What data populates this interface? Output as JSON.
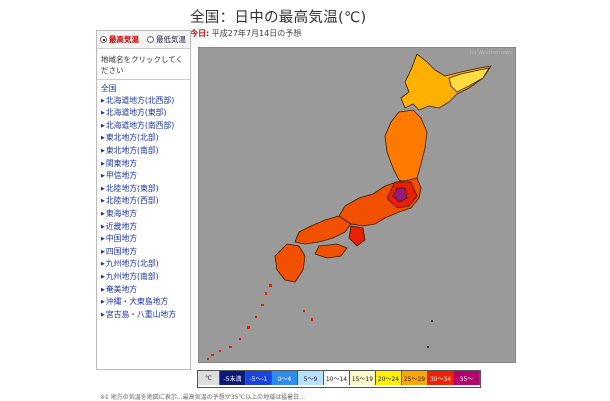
{
  "header": {
    "title": "全国：日中の最高気温(℃)",
    "today_label": "今日:",
    "date_text": "平成27年7月14日の予想"
  },
  "sidebar": {
    "options": [
      {
        "label": "最高気温",
        "selected": true
      },
      {
        "label": "最低気温",
        "selected": false
      }
    ],
    "hint": "地域名をクリックしてください",
    "regions": [
      "全国",
      "北海道地方(北西部)",
      "北海道地方(東部)",
      "北海道地方(南西部)",
      "東北地方(北部)",
      "東北地方(南部)",
      "関東地方",
      "甲信地方",
      "北陸地方(東部)",
      "北陸地方(西部)",
      "東海地方",
      "近畿地方",
      "中国地方",
      "四国地方",
      "九州地方(北部)",
      "九州地方(南部)",
      "奄美地方",
      "沖縄・大東島地方",
      "宮古島・八重山地方"
    ]
  },
  "legend": {
    "unit": "℃",
    "items": [
      {
        "label": "-5未満",
        "bg": "#0a1a7a",
        "fg": "#ffffff"
      },
      {
        "label": "-5〜-1",
        "bg": "#1a44e0",
        "fg": "#ffffff"
      },
      {
        "label": "0〜4",
        "bg": "#2d8cf0",
        "fg": "#ffffff"
      },
      {
        "label": "5〜9",
        "bg": "#b8e0ff",
        "fg": "#222222"
      },
      {
        "label": "10〜14",
        "bg": "#ffffff",
        "fg": "#222222"
      },
      {
        "label": "15〜19",
        "bg": "#fffbc8",
        "fg": "#222222"
      },
      {
        "label": "20〜24",
        "bg": "#fff200",
        "fg": "#222222"
      },
      {
        "label": "25〜29",
        "bg": "#ffa500",
        "fg": "#222222"
      },
      {
        "label": "30〜34",
        "bg": "#ee2200",
        "fg": "#ffffff"
      },
      {
        "label": "35〜",
        "bg": "#b4006e",
        "fg": "#ffffff"
      }
    ]
  },
  "map": {
    "copyright": "(c) Weathernews",
    "colors": {
      "hokkaido": "#ffb000",
      "hokkaido_east": "#ffdd40",
      "tohoku": "#ff7a00",
      "honshu": "#f05000",
      "hot": "#e82000",
      "hottest": "#9a1a7a",
      "sea": "#9a9a9a",
      "border": "#3a1a00"
    }
  },
  "footer": {
    "text": "※1 地方の気温を地図に表示…最高気温の予想が35℃以上の地域は猛暑日…"
  }
}
